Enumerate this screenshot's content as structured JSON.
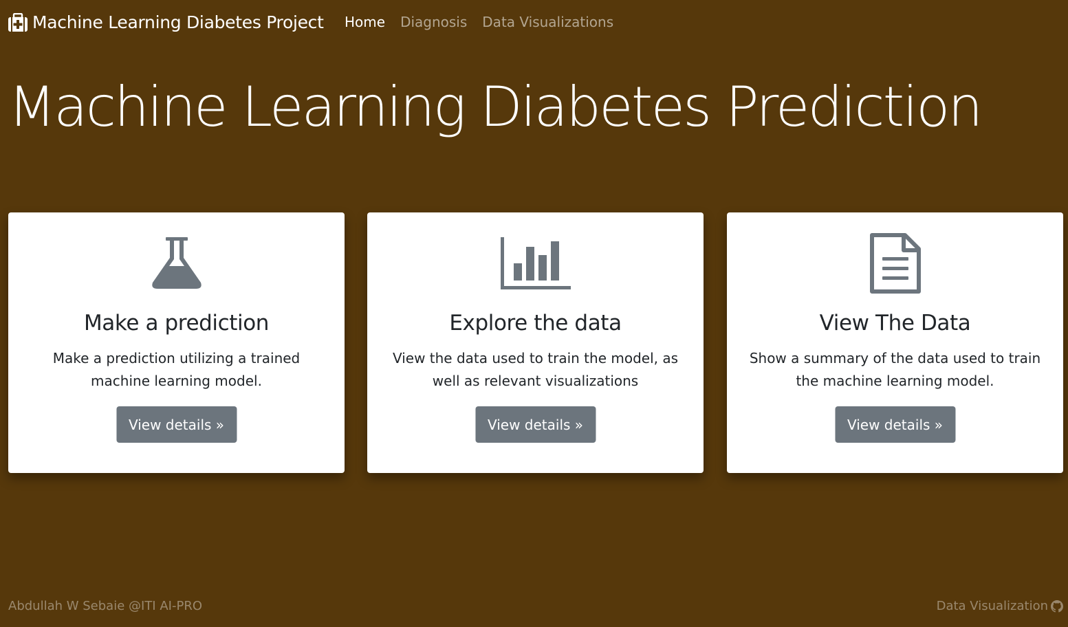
{
  "navbar": {
    "brand_icon": "medkit-icon",
    "brand": "Machine Learning Diabetes Project",
    "links": [
      {
        "label": "Home",
        "active": true
      },
      {
        "label": "Diagnosis",
        "active": false
      },
      {
        "label": "Data Visualizations",
        "active": false
      }
    ]
  },
  "hero": {
    "title": "Machine Learning Diabetes Prediction"
  },
  "cards": [
    {
      "icon": "flask-icon",
      "title": "Make a prediction",
      "text": "Make a prediction utilizing a trained machine learning model.",
      "button": "View details »"
    },
    {
      "icon": "bar-chart-icon",
      "title": "Explore the data",
      "text": "View the data used to train the model, as well as relevant visualizations",
      "button": "View details »"
    },
    {
      "icon": "document-icon",
      "title": "View The Data",
      "text": "Show a summary of the data used to train the machine learning model.",
      "button": "View details »"
    }
  ],
  "footer": {
    "left": "Abdullah W Sebaie @ITI AI-PRO",
    "right": "Data Visualization",
    "right_icon": "github-icon"
  },
  "colors": {
    "background": "#56380b",
    "card": "#ffffff",
    "button": "#6c757d",
    "icon": "#6c757d",
    "text_dark": "#212529"
  }
}
